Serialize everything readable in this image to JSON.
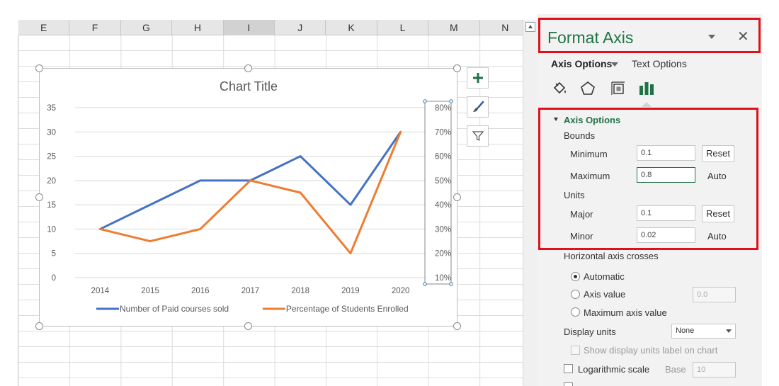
{
  "sheet": {
    "columns": [
      {
        "name": "E",
        "selected": false
      },
      {
        "name": "F",
        "selected": false
      },
      {
        "name": "G",
        "selected": false
      },
      {
        "name": "H",
        "selected": false
      },
      {
        "name": "I",
        "selected": true
      },
      {
        "name": "J",
        "selected": false
      },
      {
        "name": "K",
        "selected": false
      },
      {
        "name": "L",
        "selected": false
      },
      {
        "name": "M",
        "selected": false
      },
      {
        "name": "N",
        "selected": false
      }
    ]
  },
  "chart_data": {
    "type": "line",
    "title": "Chart Title",
    "categories": [
      "2014",
      "2015",
      "2016",
      "2017",
      "2018",
      "2019",
      "2020"
    ],
    "primary_ylim": [
      0,
      35
    ],
    "primary_yticks": [
      "0",
      "5",
      "10",
      "15",
      "20",
      "25",
      "30",
      "35"
    ],
    "secondary_ylim": [
      0.1,
      0.8
    ],
    "secondary_yticks": [
      "10%",
      "20%",
      "30%",
      "40%",
      "50%",
      "60%",
      "70%",
      "80%"
    ],
    "series": [
      {
        "name": "Number of Paid courses sold",
        "axis": "primary",
        "color": "#4472c4",
        "values": [
          10,
          15,
          20,
          20,
          25,
          15,
          30
        ]
      },
      {
        "name": "Percentage of Students Enrolled",
        "axis": "secondary",
        "color": "#ed7d31",
        "values": [
          0.3,
          0.25,
          0.3,
          0.5,
          0.45,
          0.2,
          0.7
        ]
      }
    ],
    "grid": true,
    "legend": "bottom"
  },
  "chart_tools": {
    "add_icon": "plus-icon",
    "style_icon": "brush-icon",
    "filter_icon": "funnel-icon"
  },
  "pane": {
    "title": "Format Axis",
    "tab_axis_options": "Axis Options",
    "tab_text_options": "Text Options",
    "icons": [
      "fill-line-icon",
      "effects-pentagon-icon",
      "size-properties-icon",
      "axis-options-bars-icon"
    ],
    "section_title": "Axis Options",
    "bounds_label": "Bounds",
    "minimum_label": "Minimum",
    "minimum_value": "0.1",
    "minimum_action": "Reset",
    "maximum_label": "Maximum",
    "maximum_value": "0.8",
    "maximum_action": "Auto",
    "units_label": "Units",
    "major_label": "Major",
    "major_value": "0.1",
    "major_action": "Reset",
    "minor_label": "Minor",
    "minor_value": "0.02",
    "minor_action": "Auto",
    "h_axis_crosses_label": "Horizontal axis crosses",
    "automatic_label": "Automatic",
    "axis_value_label": "Axis value",
    "axis_value_value": "0.0",
    "max_axis_value_label": "Maximum axis value",
    "display_units_label": "Display units",
    "display_units_value": "None",
    "show_units_label": "Show display units label on chart",
    "log_scale_label": "Logarithmic scale",
    "base_label": "Base",
    "base_value": "10"
  },
  "colors": {
    "accent": "#217346",
    "highlight": "#e0101a",
    "series_blue": "#4472c4",
    "series_orange": "#ed7d31"
  }
}
